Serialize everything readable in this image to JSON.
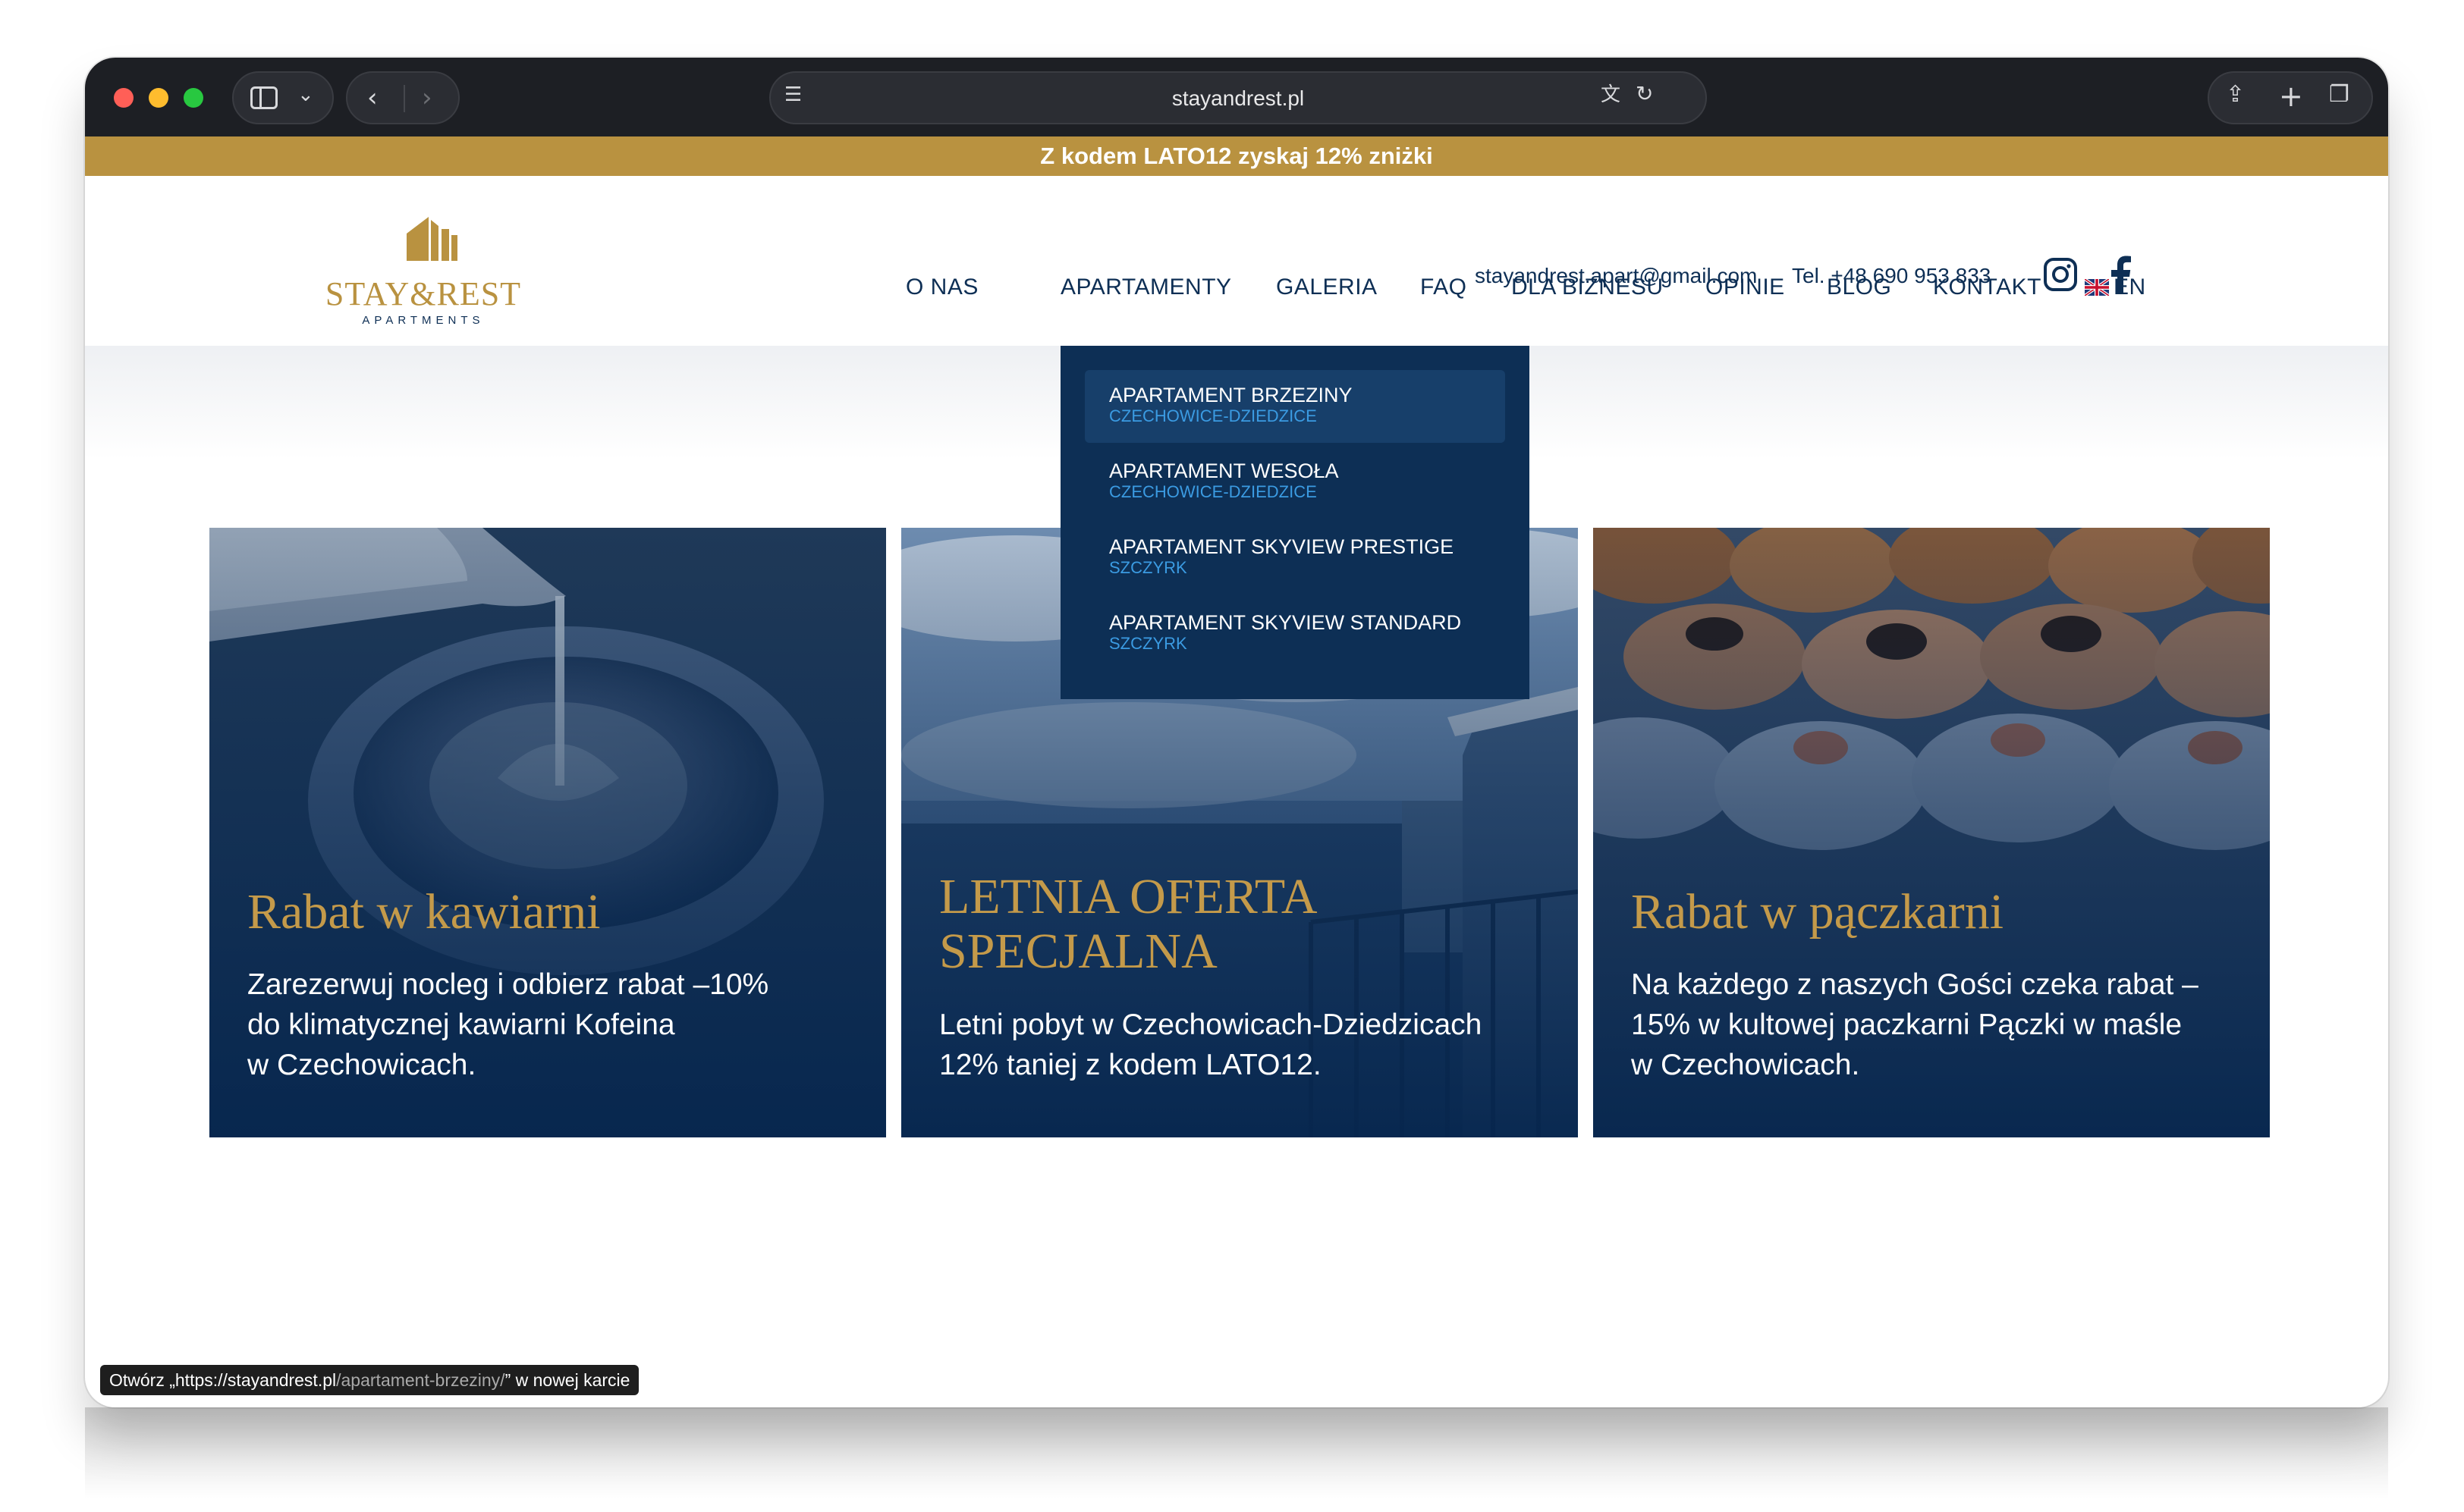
{
  "browser": {
    "url": "stayandrest.pl"
  },
  "promo": {
    "text": "Z kodem LATO12 zyskaj 12% zniżki"
  },
  "logo": {
    "word": "STAY&REST",
    "sub": "APARTMENTS"
  },
  "contact": {
    "email": "stayandrest.apart@gmail.com",
    "phone": "Tel. +48 690 953 833"
  },
  "nav": {
    "items": [
      "O NAS",
      "APARTAMENTY",
      "GALERIA",
      "FAQ",
      "DLA BIZNESU",
      "OPINIE",
      "BLOG",
      "KONTAKT"
    ],
    "lang": "EN"
  },
  "dropdown": {
    "items": [
      {
        "title": "APARTAMENT BRZEZINY",
        "sub": "CZECHOWICE-DZIEDZICE",
        "active": true
      },
      {
        "title": "APARTAMENT WESOŁA",
        "sub": "CZECHOWICE-DZIEDZICE",
        "active": false
      },
      {
        "title": "APARTAMENT SKYVIEW PRESTIGE",
        "sub": "SZCZYRK",
        "active": false
      },
      {
        "title": "APARTAMENT SKYVIEW STANDARD",
        "sub": "SZCZYRK",
        "active": false
      }
    ]
  },
  "cards": [
    {
      "title": "Rabat w kawiarni",
      "lines": [
        "Zarezerwuj nocleg i odbierz rabat –10%",
        "do klimatycznej kawiarni Kofeina",
        "w Czechowicach."
      ]
    },
    {
      "title_line1": "LETNIA OFERTA",
      "title_line2": "SPECJALNA",
      "lines": [
        "Letni pobyt w Czechowicach-Dziedzicach",
        "12% taniej z kodem LATO12."
      ]
    },
    {
      "title": "Rabat w pączkarni",
      "lines": [
        "Na każdego z naszych Gości czeka rabat –",
        "15% w kultowej paczkarni Pączki w maśle",
        "w Czechowicach."
      ]
    }
  ],
  "status": {
    "prefix": "Otwórz „https://stayandrest.pl",
    "path": "/apartament-brzeziny/",
    "suffix": "” w nowej karcie"
  },
  "colors": {
    "navy": "#0e2f55",
    "gold": "#b99240",
    "dropdown_bg": "#0d2f55",
    "dropdown_sub": "#3b9be2"
  }
}
